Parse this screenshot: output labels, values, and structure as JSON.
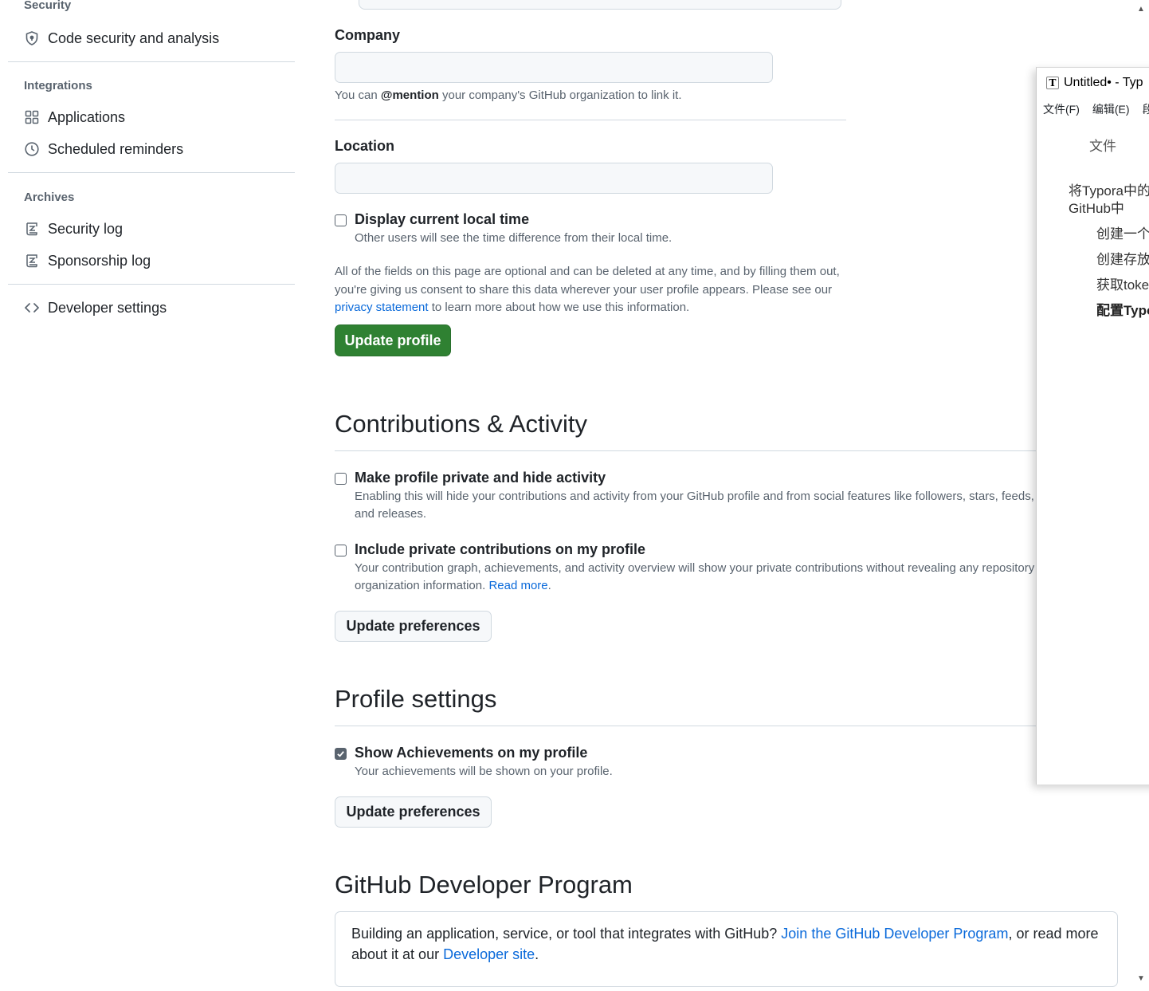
{
  "sidebar": {
    "security_heading": "Security",
    "security_items": [
      {
        "label": "Code security and analysis",
        "icon": "shield-icon"
      }
    ],
    "integrations_heading": "Integrations",
    "integrations_items": [
      {
        "label": "Applications",
        "icon": "apps-grid-icon"
      },
      {
        "label": "Scheduled reminders",
        "icon": "clock-icon"
      }
    ],
    "archives_heading": "Archives",
    "archives_items": [
      {
        "label": "Security log",
        "icon": "log-icon"
      },
      {
        "label": "Sponsorship log",
        "icon": "log-icon"
      }
    ],
    "developer_settings": {
      "label": "Developer settings",
      "icon": "code-icon"
    }
  },
  "profile_form": {
    "company_label": "Company",
    "company_value": "",
    "company_note_prefix": "You can ",
    "company_note_mention": "@mention",
    "company_note_suffix": " your company's GitHub organization to link it.",
    "location_label": "Location",
    "location_value": "",
    "local_time_label": "Display current local time",
    "local_time_note": "Other users will see the time difference from their local time.",
    "local_time_checked": false,
    "consent_text_1": "All of the fields on this page are optional and can be deleted at any time, and by filling them out,",
    "consent_text_2": "you're giving us consent to share this data wherever your user profile appears. Please see our",
    "consent_link": "privacy statement",
    "consent_text_3": " to learn more about how we use this information.",
    "update_button": "Update profile"
  },
  "contributions": {
    "heading": "Contributions & Activity",
    "private_label": "Make profile private and hide activity",
    "private_note_1": "Enabling this will hide your contributions and activity from your GitHub profile and from social features like followers, stars, feeds,",
    "private_note_2": "and releases.",
    "private_checked": false,
    "include_label": "Include private contributions on my profile",
    "include_note_1": "Your contribution graph, achievements, and activity overview will show your private contributions without revealing any repository",
    "include_note_2": "organization information. ",
    "include_note_link": "Read more",
    "include_note_end": ".",
    "include_checked": false,
    "update_button": "Update preferences"
  },
  "profile_settings": {
    "heading": "Profile settings",
    "achievements_label": "Show Achievements on my profile",
    "achievements_note": "Your achievements will be shown on your profile.",
    "achievements_checked": true,
    "update_button": "Update preferences"
  },
  "developer_program": {
    "heading": "GitHub Developer Program",
    "text_1": "Building an application, service, or tool that integrates with GitHub? ",
    "link_1": "Join the GitHub Developer Program",
    "text_2": ", or read more",
    "text_3": "about it at our ",
    "link_2": "Developer site",
    "text_4": "."
  },
  "typora_window": {
    "title": "Untitled• - Typ",
    "logo_letter": "T",
    "menu": [
      "文件(F)",
      "编辑(E)",
      "段"
    ],
    "panel_title": "文件",
    "outline": [
      "将Typora中的",
      "GitHub中",
      "创建一个",
      "创建存放",
      "获取toke",
      "配置Typo"
    ]
  },
  "colors": {
    "accent_green": "#2f8132",
    "link_blue": "#0969da",
    "muted_text": "#59636e",
    "border": "#d1d9e0"
  }
}
